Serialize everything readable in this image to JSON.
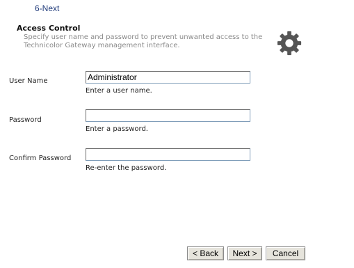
{
  "step": {
    "title": "6-Next"
  },
  "header": {
    "title": "Access Control",
    "description": "Specify user name and password to prevent unwanted access to the Technicolor Gateway management interface.",
    "icon": "gear-icon"
  },
  "form": {
    "username": {
      "label": "User Name",
      "value": "Administrator",
      "hint": "Enter a user name."
    },
    "password": {
      "label": "Password",
      "value": "",
      "hint": "Enter a password."
    },
    "confirm": {
      "label": "Confirm Password",
      "value": "",
      "hint": "Re-enter the password."
    }
  },
  "buttons": {
    "back": "< Back",
    "next": "Next >",
    "cancel": "Cancel"
  }
}
